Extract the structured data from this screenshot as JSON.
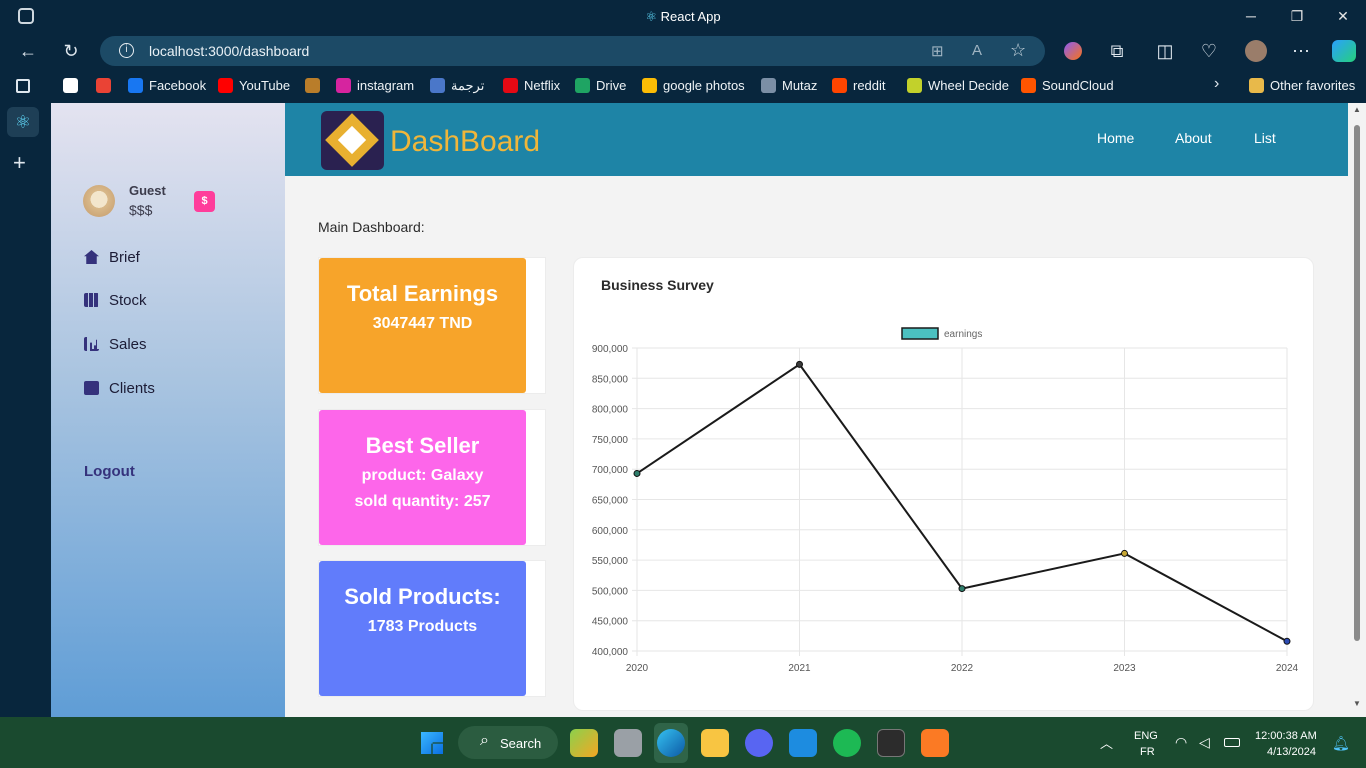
{
  "window": {
    "title": "React App"
  },
  "browser": {
    "url": "localhost:3000/dashboard",
    "favorites": [
      {
        "label": "",
        "color": "#ffffff"
      },
      {
        "label": "",
        "color": "#ea4335"
      },
      {
        "label": "Facebook",
        "color": "#1877f2"
      },
      {
        "label": "YouTube",
        "color": "#ff0000"
      },
      {
        "label": "",
        "color": "#b97d2a"
      },
      {
        "label": "instagram",
        "color": "#d6249f"
      },
      {
        "label": "ترجمة",
        "color": "#4a77c9"
      },
      {
        "label": "Netflix",
        "color": "#e50914"
      },
      {
        "label": "Drive",
        "color": "#1fa463"
      },
      {
        "label": "google photos",
        "color": "#fbbc05"
      },
      {
        "label": "Mutaz",
        "color": "#7b8fa6"
      },
      {
        "label": "reddit",
        "color": "#ff4500"
      },
      {
        "label": "Wheel Decide",
        "color": "#c2d12b"
      },
      {
        "label": "SoundCloud",
        "color": "#ff5500"
      }
    ],
    "other_favorites": "Other favorites"
  },
  "app": {
    "brand": "DashBoard",
    "nav": [
      "Home",
      "About",
      "List"
    ],
    "user": {
      "name": "Guest",
      "balance": "$$$",
      "badge": "$"
    },
    "menu": [
      "Brief",
      "Stock",
      "Sales",
      "Clients"
    ],
    "logout": "Logout",
    "section_title": "Main Dashboard:",
    "cards": [
      {
        "title": "Total Earnings",
        "lines": [
          "3047447 TND"
        ],
        "color": "#f7a42a"
      },
      {
        "title": "Best Seller",
        "lines": [
          "product: Galaxy",
          "sold quantity: 257"
        ],
        "color": "#fd66ea"
      },
      {
        "title": "Sold Products:",
        "lines": [
          "1783 Products"
        ],
        "color": "#617cfb"
      }
    ],
    "chart_panel_title": "Business Survey"
  },
  "chart_data": {
    "type": "line",
    "categories": [
      "2020",
      "2021",
      "2022",
      "2023",
      "2024"
    ],
    "series": [
      {
        "name": "earnings",
        "values": [
          693000,
          873000,
          503000,
          561000,
          416000
        ]
      }
    ],
    "ylim": [
      400000,
      900000
    ],
    "yticks": [
      "900,000",
      "850,000",
      "800,000",
      "750,000",
      "700,000",
      "650,000",
      "600,000",
      "550,000",
      "500,000",
      "450,000",
      "400,000"
    ],
    "grid": true,
    "legend": "top",
    "legend_color": "#4bc0c0",
    "line_color": "#1a1a1a",
    "point_colors": [
      "#2e7d6b",
      "#3a3a3a",
      "#2e7d6b",
      "#c7a733",
      "#2c4bb3"
    ]
  },
  "taskbar": {
    "search": "Search",
    "lang": "ENG",
    "lang2": "FR",
    "time": "12:00:38 AM",
    "date": "4/13/2024"
  }
}
